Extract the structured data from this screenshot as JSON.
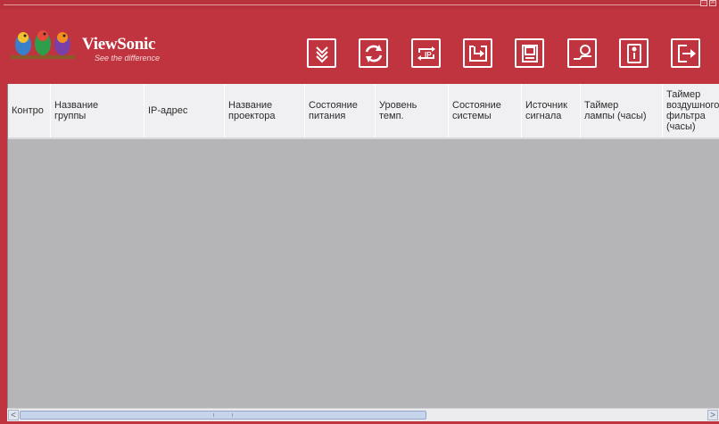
{
  "window": {
    "restore_glyph": "□",
    "close_glyph": "☒"
  },
  "brand": {
    "name": "ViewSonic",
    "tagline": "See the difference"
  },
  "toolbar": {
    "buttons": [
      {
        "name": "collapse-icon"
      },
      {
        "name": "refresh-icon"
      },
      {
        "name": "ip-transfer-icon"
      },
      {
        "name": "export-icon"
      },
      {
        "name": "save-icon"
      },
      {
        "name": "settings-icon"
      },
      {
        "name": "info-icon"
      },
      {
        "name": "exit-icon"
      }
    ]
  },
  "table": {
    "columns": [
      "Контро",
      "Название\nгруппы",
      "IP-адрес",
      "Название\nпроектора",
      "Состояние\nпитания",
      "Уровень\nтемп.",
      "Состояние\nсистемы",
      "Источник\nсигнала",
      "Таймер\nлампы (часы)",
      "Таймер\nвоздушного\nфильтра\n(часы)"
    ],
    "rows": []
  },
  "scrollbar": {
    "left_arrow": "<",
    "right_arrow": ">"
  },
  "colors": {
    "brand_red": "#c0343f",
    "table_bg": "#b5b5b8",
    "header_bg": "#f0f0f2"
  }
}
